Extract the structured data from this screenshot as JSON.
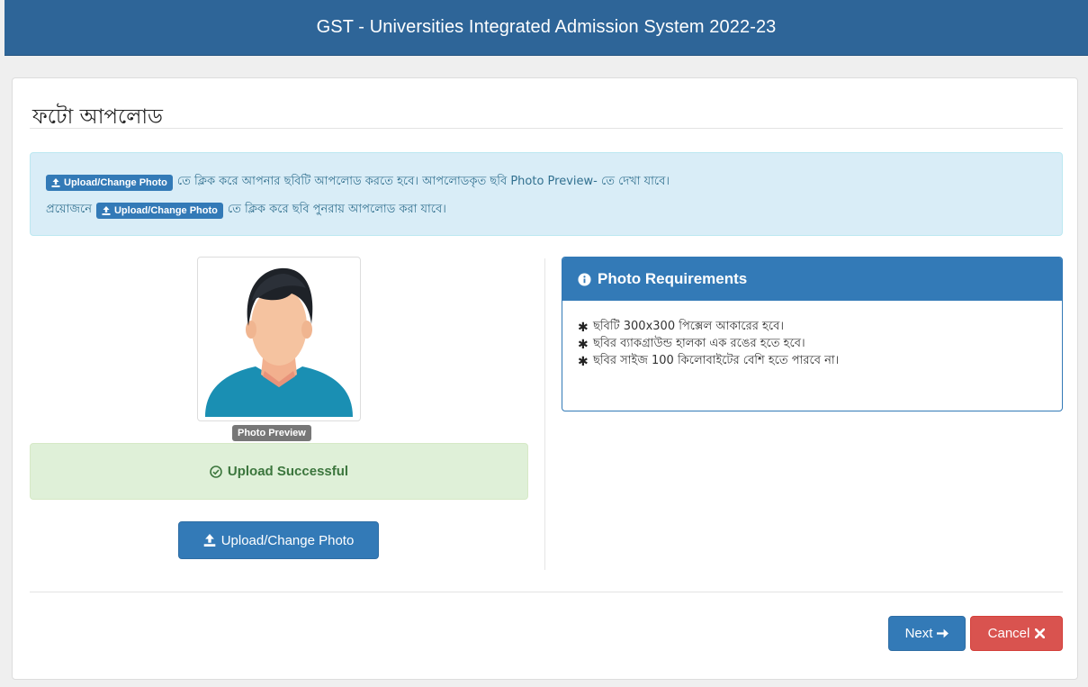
{
  "header": {
    "title": "GST - Universities Integrated Admission System 2022-23"
  },
  "page": {
    "title": "ফটো আপলোড"
  },
  "info": {
    "button_label": "Upload/Change Photo",
    "line1_text": "তে ক্লিক করে আপনার ছবিটি আপলোড করতে হবে। আপলোডকৃত ছবি Photo Preview- তে দেখা যাবে।",
    "line2_prefix": "প্রয়োজনে",
    "line2_text": "তে ক্লিক করে ছবি পুনরায় আপলোড করা যাবে।"
  },
  "photo": {
    "preview_label": "Photo Preview",
    "status_text": "Upload Successful",
    "upload_button_label": "Upload/Change Photo"
  },
  "requirements": {
    "title": "Photo Requirements",
    "items": [
      "ছবিটি 300x300 পিক্সেল আকারের হবে।",
      "ছবির ব্যাকগ্রাউন্ড হালকা এক রঙের হতে হবে।",
      "ছবির সাইজ 100 কিলোবাইটের বেশি হতে পারবে না।"
    ]
  },
  "footer": {
    "next_label": "Next",
    "cancel_label": "Cancel"
  },
  "colors": {
    "primary": "#337ab7",
    "danger": "#d9534f",
    "success_bg": "#dff0d8",
    "info_bg": "#d9edf7",
    "header_bg": "#2e6598"
  }
}
